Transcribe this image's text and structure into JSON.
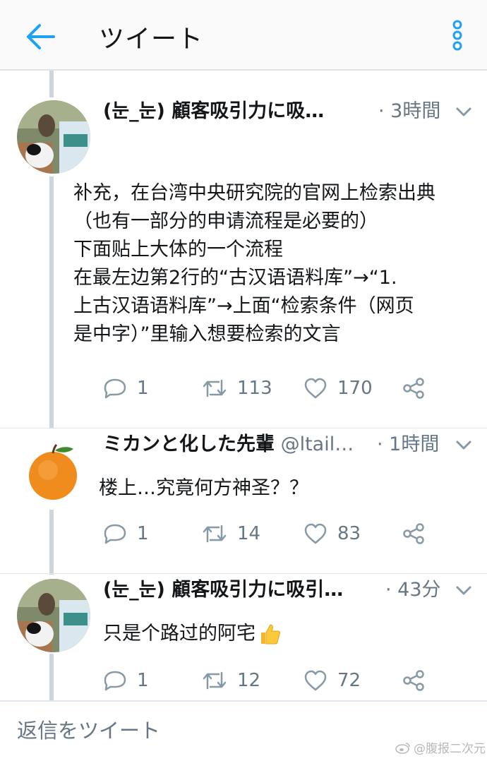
{
  "header": {
    "title": "ツイート",
    "back_icon": "arrow-left-icon",
    "more_icon": "vertical-dots-icon",
    "accent_color": "#1da1f2"
  },
  "tweets": [
    {
      "name": "(눈_눈) 顧客吸引力に吸…",
      "handle": "",
      "time": "· 3時間",
      "avatar": "photo-avatar",
      "lines": [
        "补充，在台湾中央研究院的官网上检索出典",
        "（也有一部分的申请流程是必要的）",
        "下面贴上大体的一个流程",
        "在最左边第2行的“古汉语语料库”→“1.",
        "上古汉语语料库”→上面“检索条件（网页",
        "是中字）”里输入想要检索的文言"
      ],
      "replies": "1",
      "retweets": "113",
      "likes": "170"
    },
    {
      "name": "ミカンと化した先輩",
      "handle": " @ltail…",
      "time": "· 1時間",
      "avatar": "orange-avatar",
      "lines": [
        "楼上…究竟何方神圣？？"
      ],
      "replies": "1",
      "retweets": "14",
      "likes": "83"
    },
    {
      "name": "(눈_눈) 顧客吸引力に吸引…",
      "handle": "",
      "time": "· 43分",
      "avatar": "photo-avatar",
      "lines": [
        "只是个路过的阿宅"
      ],
      "emoji": "thumbs-up-icon",
      "replies": "1",
      "retweets": "12",
      "likes": "72"
    }
  ],
  "reply_box": {
    "placeholder": "返信をツイート"
  },
  "watermark": {
    "text": "@腹报二次元",
    "icon": "weibo-icon"
  }
}
